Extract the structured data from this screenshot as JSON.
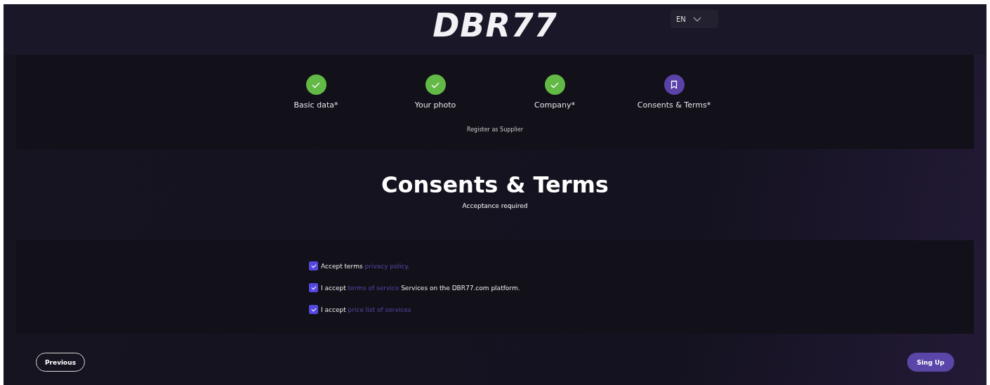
{
  "header": {
    "logo": "DBR77",
    "language": "EN"
  },
  "steps": [
    {
      "label": "Basic data*",
      "done": true
    },
    {
      "label": "Your photo",
      "done": true
    },
    {
      "label": "Company*",
      "done": true
    },
    {
      "label": "Consents & Terms*",
      "done": false
    }
  ],
  "register_as": "Register as  Supplier",
  "heading": "Consents & Terms",
  "subheading": "Acceptance required",
  "consents": [
    {
      "text": "Accept terms",
      "link": "privacy policy.",
      "checked": true
    },
    {
      "text": "I accept",
      "link": "terms of service",
      "suffix": "Services on the DBR77.com platform.",
      "checked": true
    },
    {
      "text": "I accept",
      "link": "price list of services",
      "checked": true
    }
  ],
  "buttons": {
    "previous": "Previous",
    "submit": "Sing Up"
  }
}
